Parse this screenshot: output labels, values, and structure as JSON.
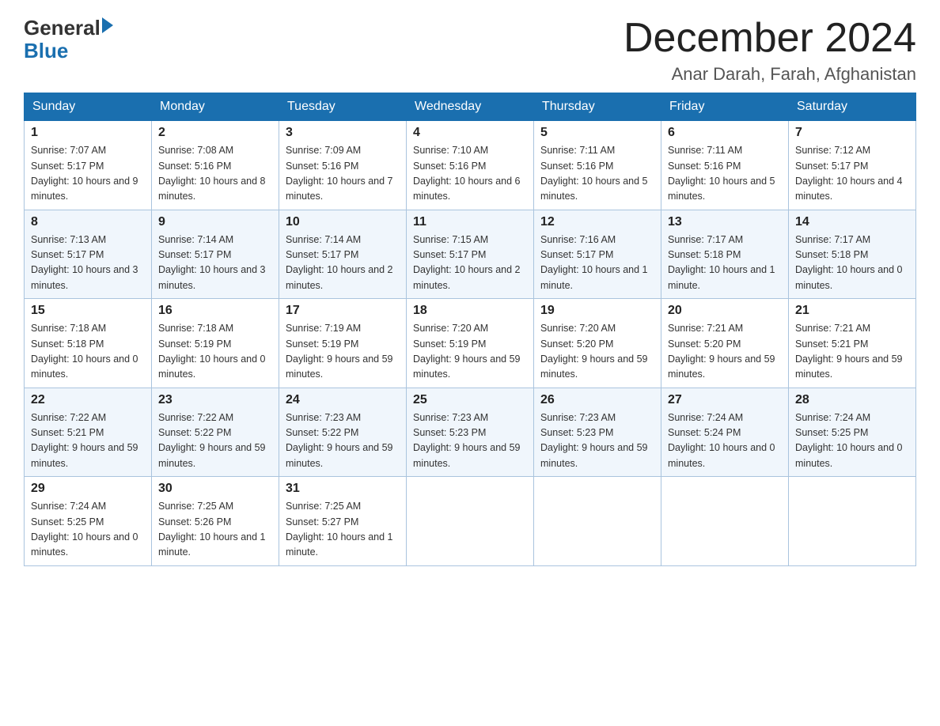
{
  "logo": {
    "general": "General",
    "arrow": "▶",
    "blue": "Blue"
  },
  "header": {
    "month": "December 2024",
    "location": "Anar Darah, Farah, Afghanistan"
  },
  "days_of_week": [
    "Sunday",
    "Monday",
    "Tuesday",
    "Wednesday",
    "Thursday",
    "Friday",
    "Saturday"
  ],
  "weeks": [
    [
      {
        "day": "1",
        "sunrise": "7:07 AM",
        "sunset": "5:17 PM",
        "daylight": "10 hours and 9 minutes."
      },
      {
        "day": "2",
        "sunrise": "7:08 AM",
        "sunset": "5:16 PM",
        "daylight": "10 hours and 8 minutes."
      },
      {
        "day": "3",
        "sunrise": "7:09 AM",
        "sunset": "5:16 PM",
        "daylight": "10 hours and 7 minutes."
      },
      {
        "day": "4",
        "sunrise": "7:10 AM",
        "sunset": "5:16 PM",
        "daylight": "10 hours and 6 minutes."
      },
      {
        "day": "5",
        "sunrise": "7:11 AM",
        "sunset": "5:16 PM",
        "daylight": "10 hours and 5 minutes."
      },
      {
        "day": "6",
        "sunrise": "7:11 AM",
        "sunset": "5:16 PM",
        "daylight": "10 hours and 5 minutes."
      },
      {
        "day": "7",
        "sunrise": "7:12 AM",
        "sunset": "5:17 PM",
        "daylight": "10 hours and 4 minutes."
      }
    ],
    [
      {
        "day": "8",
        "sunrise": "7:13 AM",
        "sunset": "5:17 PM",
        "daylight": "10 hours and 3 minutes."
      },
      {
        "day": "9",
        "sunrise": "7:14 AM",
        "sunset": "5:17 PM",
        "daylight": "10 hours and 3 minutes."
      },
      {
        "day": "10",
        "sunrise": "7:14 AM",
        "sunset": "5:17 PM",
        "daylight": "10 hours and 2 minutes."
      },
      {
        "day": "11",
        "sunrise": "7:15 AM",
        "sunset": "5:17 PM",
        "daylight": "10 hours and 2 minutes."
      },
      {
        "day": "12",
        "sunrise": "7:16 AM",
        "sunset": "5:17 PM",
        "daylight": "10 hours and 1 minute."
      },
      {
        "day": "13",
        "sunrise": "7:17 AM",
        "sunset": "5:18 PM",
        "daylight": "10 hours and 1 minute."
      },
      {
        "day": "14",
        "sunrise": "7:17 AM",
        "sunset": "5:18 PM",
        "daylight": "10 hours and 0 minutes."
      }
    ],
    [
      {
        "day": "15",
        "sunrise": "7:18 AM",
        "sunset": "5:18 PM",
        "daylight": "10 hours and 0 minutes."
      },
      {
        "day": "16",
        "sunrise": "7:18 AM",
        "sunset": "5:19 PM",
        "daylight": "10 hours and 0 minutes."
      },
      {
        "day": "17",
        "sunrise": "7:19 AM",
        "sunset": "5:19 PM",
        "daylight": "9 hours and 59 minutes."
      },
      {
        "day": "18",
        "sunrise": "7:20 AM",
        "sunset": "5:19 PM",
        "daylight": "9 hours and 59 minutes."
      },
      {
        "day": "19",
        "sunrise": "7:20 AM",
        "sunset": "5:20 PM",
        "daylight": "9 hours and 59 minutes."
      },
      {
        "day": "20",
        "sunrise": "7:21 AM",
        "sunset": "5:20 PM",
        "daylight": "9 hours and 59 minutes."
      },
      {
        "day": "21",
        "sunrise": "7:21 AM",
        "sunset": "5:21 PM",
        "daylight": "9 hours and 59 minutes."
      }
    ],
    [
      {
        "day": "22",
        "sunrise": "7:22 AM",
        "sunset": "5:21 PM",
        "daylight": "9 hours and 59 minutes."
      },
      {
        "day": "23",
        "sunrise": "7:22 AM",
        "sunset": "5:22 PM",
        "daylight": "9 hours and 59 minutes."
      },
      {
        "day": "24",
        "sunrise": "7:23 AM",
        "sunset": "5:22 PM",
        "daylight": "9 hours and 59 minutes."
      },
      {
        "day": "25",
        "sunrise": "7:23 AM",
        "sunset": "5:23 PM",
        "daylight": "9 hours and 59 minutes."
      },
      {
        "day": "26",
        "sunrise": "7:23 AM",
        "sunset": "5:23 PM",
        "daylight": "9 hours and 59 minutes."
      },
      {
        "day": "27",
        "sunrise": "7:24 AM",
        "sunset": "5:24 PM",
        "daylight": "10 hours and 0 minutes."
      },
      {
        "day": "28",
        "sunrise": "7:24 AM",
        "sunset": "5:25 PM",
        "daylight": "10 hours and 0 minutes."
      }
    ],
    [
      {
        "day": "29",
        "sunrise": "7:24 AM",
        "sunset": "5:25 PM",
        "daylight": "10 hours and 0 minutes."
      },
      {
        "day": "30",
        "sunrise": "7:25 AM",
        "sunset": "5:26 PM",
        "daylight": "10 hours and 1 minute."
      },
      {
        "day": "31",
        "sunrise": "7:25 AM",
        "sunset": "5:27 PM",
        "daylight": "10 hours and 1 minute."
      },
      null,
      null,
      null,
      null
    ]
  ]
}
